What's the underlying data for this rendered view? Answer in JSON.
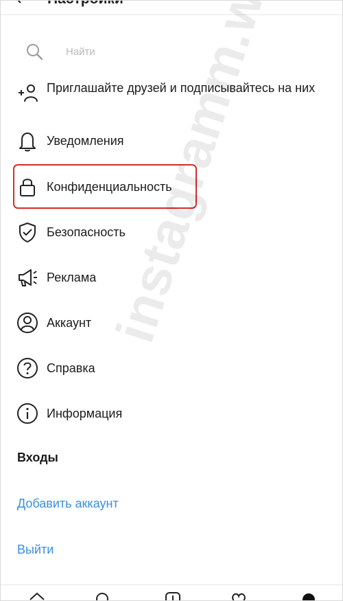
{
  "header": {
    "title": "Настройки"
  },
  "search": {
    "placeholder": "Найти"
  },
  "menu": [
    {
      "icon": "add-user-icon",
      "label": "Приглашайте друзей и подписывайтесь на них"
    },
    {
      "icon": "bell-icon",
      "label": "Уведомления"
    },
    {
      "icon": "lock-icon",
      "label": "Конфиденциальность"
    },
    {
      "icon": "shield-check-icon",
      "label": "Безопасность"
    },
    {
      "icon": "megaphone-icon",
      "label": "Реклама"
    },
    {
      "icon": "account-icon",
      "label": "Аккаунт"
    },
    {
      "icon": "help-icon",
      "label": "Справка"
    },
    {
      "icon": "info-icon",
      "label": "Информация"
    }
  ],
  "logins": {
    "title": "Входы",
    "add_account": "Добавить аккаунт",
    "logout": "Выйти"
  },
  "watermark": "instagramm.wiki",
  "colors": {
    "link": "#3a8fe0",
    "highlight": "#d62b2b",
    "text": "#1b1b1b"
  },
  "bottom_nav": [
    "home-icon",
    "search-icon",
    "add-icon",
    "heart-icon",
    "profile-icon"
  ]
}
